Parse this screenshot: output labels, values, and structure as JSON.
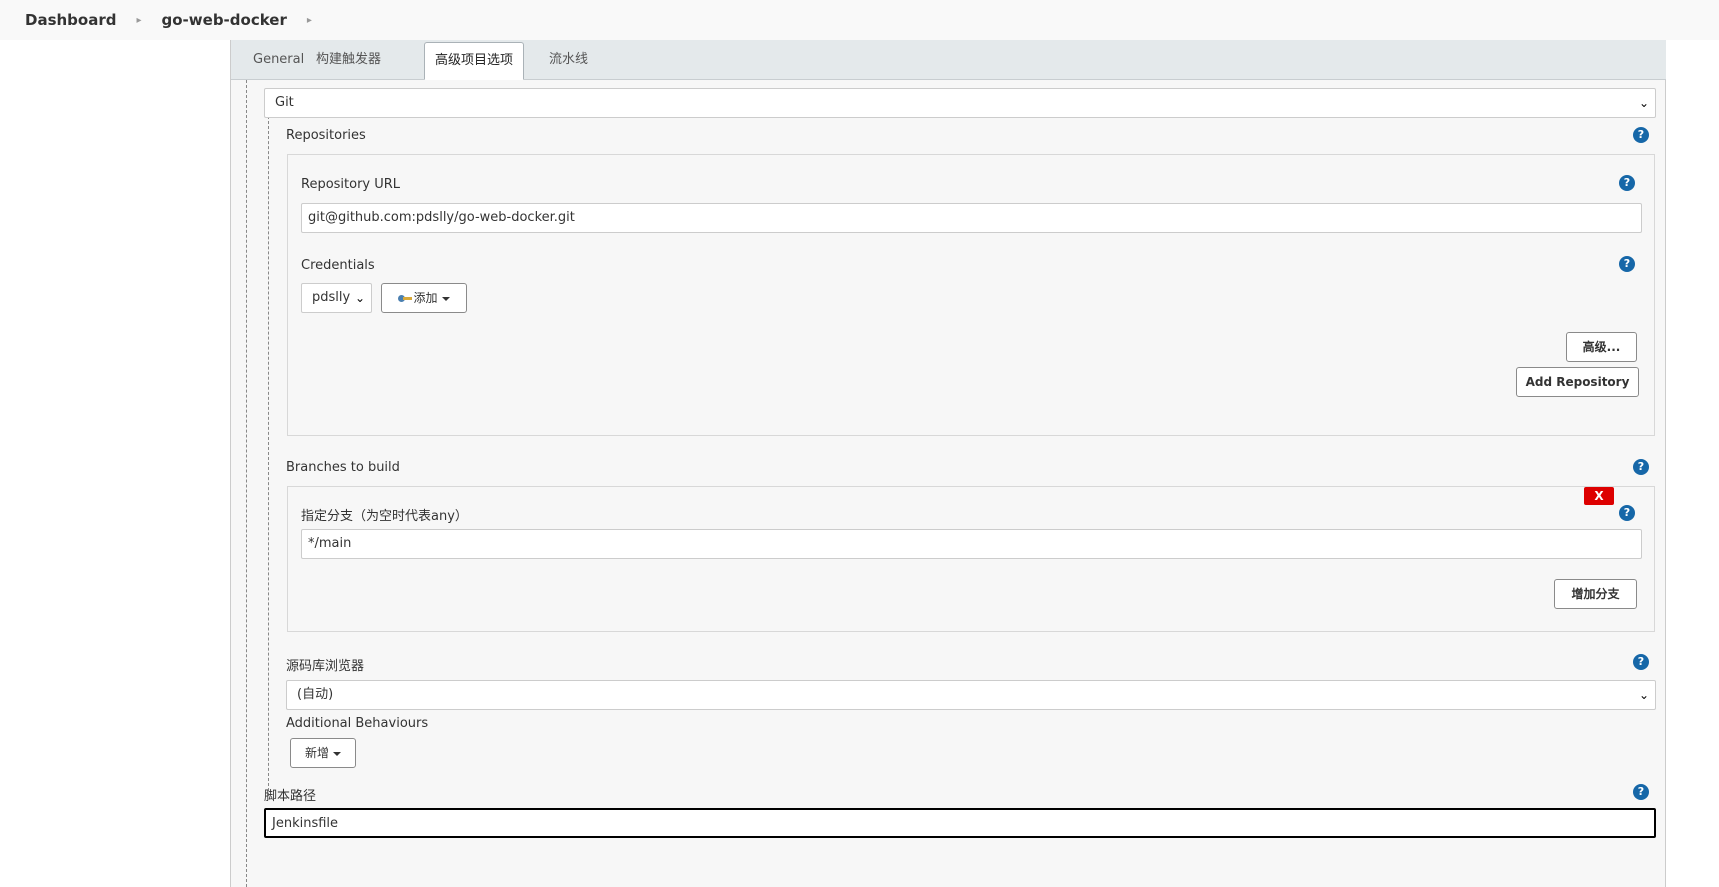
{
  "breadcrumb": {
    "items": [
      "Dashboard",
      "go-web-docker"
    ]
  },
  "tabs": [
    {
      "label": "General"
    },
    {
      "label": "构建触发器"
    },
    {
      "label": "高级项目选项"
    },
    {
      "label": "流水线"
    }
  ],
  "scm": {
    "selected": "Git"
  },
  "repositories": {
    "title": "Repositories",
    "url_label": "Repository URL",
    "url_value": "git@github.com:pdslly/go-web-docker.git",
    "credentials_label": "Credentials",
    "credentials_value": "pdslly",
    "add_label": "添加",
    "advanced_label": "高级...",
    "add_repository_label": "Add Repository"
  },
  "branches": {
    "title": "Branches to build",
    "delete_label": "X",
    "branch_label": "指定分支（为空时代表any）",
    "branch_value": "*/main",
    "add_branch_label": "增加分支"
  },
  "browser": {
    "label": "源码库浏览器",
    "selected": "(自动)"
  },
  "behaviours": {
    "label": "Additional Behaviours",
    "add_label": "新增"
  },
  "script_path": {
    "label": "脚本路径",
    "value": "Jenkinsfile"
  },
  "icons": {
    "help": "?",
    "chevron": "❯",
    "breadcrumb_sep": "▸"
  },
  "colors": {
    "help_icon": "#1667a8",
    "delete_button": "#dd0000"
  }
}
